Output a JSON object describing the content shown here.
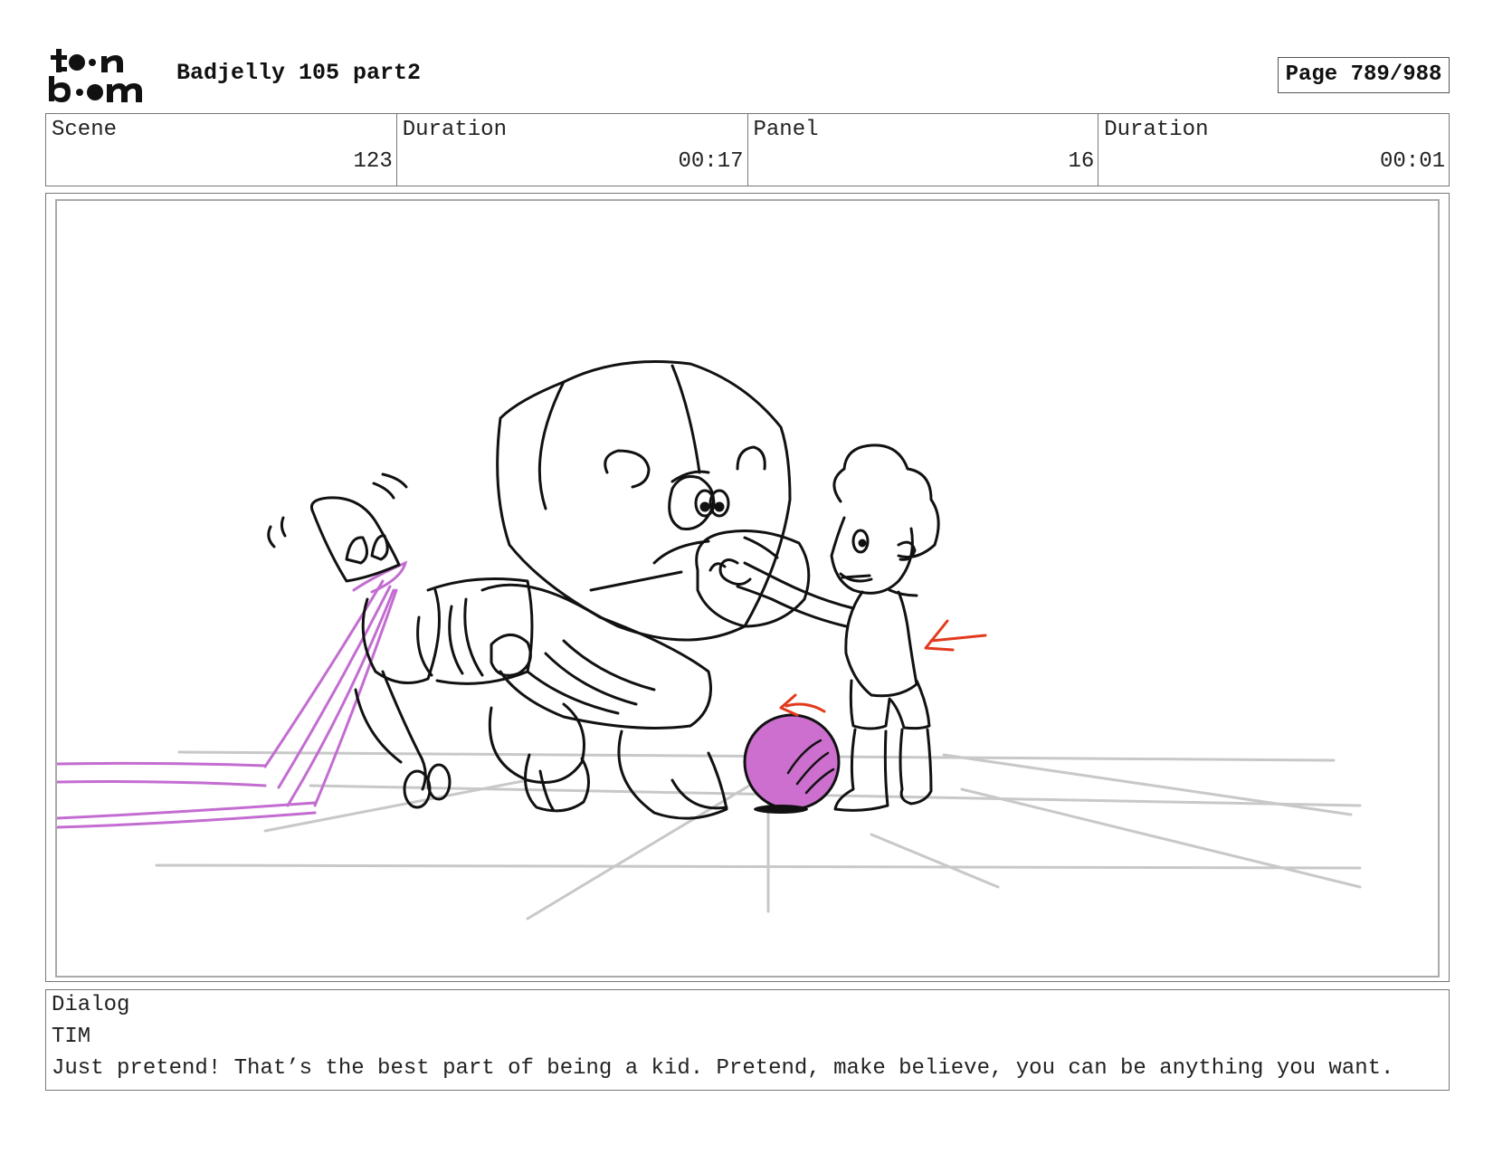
{
  "header": {
    "logo_text": "toon boom",
    "project_title": "Badjelly 105 part2",
    "page_label": "Page 789/988"
  },
  "meta": {
    "scene_label": "Scene",
    "scene_value": "123",
    "scene_duration_label": "Duration",
    "scene_duration_value": "00:17",
    "panel_label": "Panel",
    "panel_value": "16",
    "panel_duration_label": "Duration",
    "panel_duration_value": "00:01"
  },
  "dialog": {
    "label": "Dialog",
    "speaker": "TIM",
    "line": "Just pretend! That’s the best part of being a kid. Pretend, make believe, you can be anything you want."
  },
  "colors": {
    "sketch_line": "#111111",
    "floor_line": "#c8c8c8",
    "ribbon": "#c36cd1",
    "ball": "#cc6fcf",
    "arrow": "#e23a1c"
  }
}
